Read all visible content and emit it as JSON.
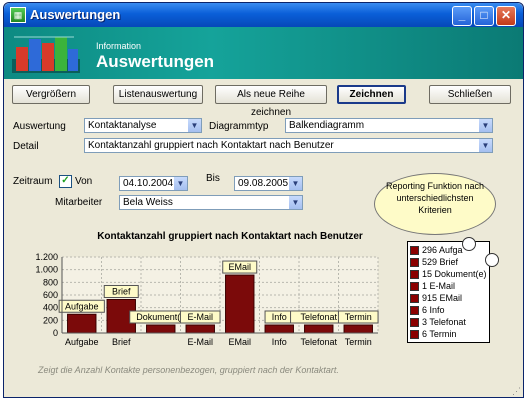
{
  "window": {
    "title": "Auswertungen"
  },
  "header": {
    "small": "Information",
    "big": "Auswertungen"
  },
  "toolbar": {
    "vergroessern": "Vergrößern",
    "listenauswertung": "Listenauswertung",
    "neue_reihe": "Als neue Reihe zeichnen",
    "zeichnen": "Zeichnen",
    "schliessen": "Schließen"
  },
  "form": {
    "auswertung_label": "Auswertung",
    "auswertung_value": "Kontaktanalyse",
    "diagrammtyp_label": "Diagrammtyp",
    "diagrammtyp_value": "Balkendiagramm",
    "detail_label": "Detail",
    "detail_value": "Kontaktanzahl gruppiert nach Kontaktart nach Benutzer",
    "zeitraum_label": "Zeitraum",
    "von_label": "Von",
    "von_value": "04.10.2004",
    "bis_label": "Bis",
    "bis_value": "09.08.2005",
    "mitarbeiter_label": "Mitarbeiter",
    "mitarbeiter_value": "Bela Weiss"
  },
  "bubble_text": "Reporting Funktion nach unterschiedlichsten Kriterien",
  "note": "Zeigt die Anzahl Kontakte personenbezogen, gruppiert nach der Kontaktart.",
  "colors": {
    "bar": "#7b0a0a",
    "label_bg": "#fefbc8",
    "header": "#0d8a82"
  },
  "chart_data": {
    "type": "bar",
    "title": "Kontaktanzahl gruppiert nach Kontaktart nach Benutzer",
    "categories": [
      "Aufgabe",
      "Brief",
      "Dokument(e)",
      "E-Mail",
      "EMail",
      "Info",
      "Telefonat",
      "Termin"
    ],
    "x_tick_labels": [
      "Aufgabe",
      "Brief",
      "",
      "E-Mail",
      "EMail",
      "Info",
      "Telefonat",
      "Termin"
    ],
    "values": [
      296,
      529,
      15,
      1,
      915,
      6,
      3,
      6
    ],
    "value_labels": [
      "Aufgabe",
      "Brief",
      "Dokument(e",
      "E-Mail",
      "EMail",
      "Info",
      "Telefonat",
      "Termin"
    ],
    "y_ticks": [
      "0",
      "200",
      "400",
      "600",
      "800",
      "1.000",
      "1.200"
    ],
    "ylim": [
      0,
      1200
    ],
    "grid": true,
    "legend": [
      "296 Aufga",
      "529 Brief",
      "15 Dokument(e)",
      "1 E-Mail",
      "915 EMail",
      "6 Info",
      "3 Telefonat",
      "6 Termin"
    ],
    "legend_placement": "right"
  }
}
